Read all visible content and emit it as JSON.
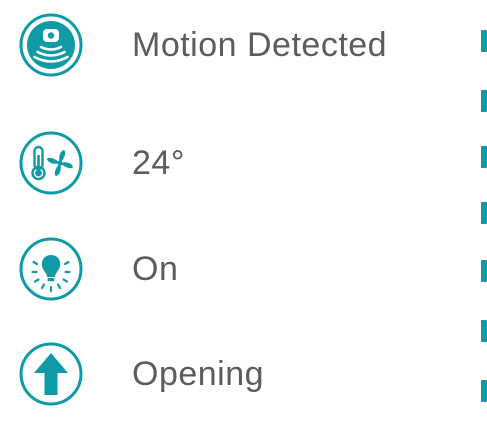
{
  "colors": {
    "accent": "#0f9aa6",
    "text": "#5c5c5c",
    "background": "#ffffff"
  },
  "statuses": [
    {
      "icon": "motion-sensor-icon",
      "label": "Motion Detected"
    },
    {
      "icon": "thermostat-fan-icon",
      "label": "24°"
    },
    {
      "icon": "light-bulb-icon",
      "label": "On"
    },
    {
      "icon": "up-arrow-icon",
      "label": "Opening"
    }
  ]
}
